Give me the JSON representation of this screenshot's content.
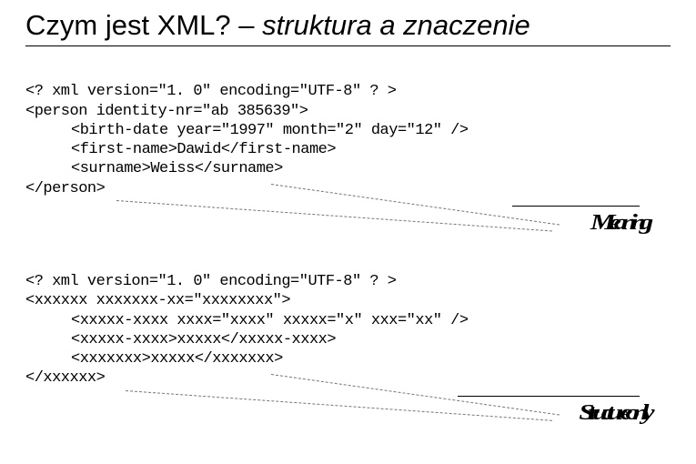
{
  "title": {
    "plain": "Czym jest XML? – ",
    "italic": "struktura a znaczenie"
  },
  "code1": {
    "l1": "<? xml version=\"1. 0\" encoding=\"UTF-8\" ? >",
    "l2": "<person identity-nr=\"ab 385639\">",
    "l3": "<birth-date year=\"1997\" month=\"2\" day=\"12\" />",
    "l4": "<first-name>Dawid</first-name>",
    "l5": "<surname>Weiss</surname>",
    "l6": "</person>"
  },
  "ann1": {
    "label": "Meaning"
  },
  "code2": {
    "l1": "<? xml version=\"1. 0\" encoding=\"UTF-8\" ? >",
    "l2": "<xxxxxx xxxxxxx-xx=\"xxxxxxxx\">",
    "l3": "<xxxxx-xxxx xxxx=\"xxxx\" xxxxx=\"x\" xxx=\"xx\" />",
    "l4": "<xxxxx-xxxx>xxxxx</xxxxx-xxxx>",
    "l5": "<xxxxxxx>xxxxx</xxxxxxx>",
    "l6": "</xxxxxx>"
  },
  "ann2": {
    "label": "Structure only"
  }
}
